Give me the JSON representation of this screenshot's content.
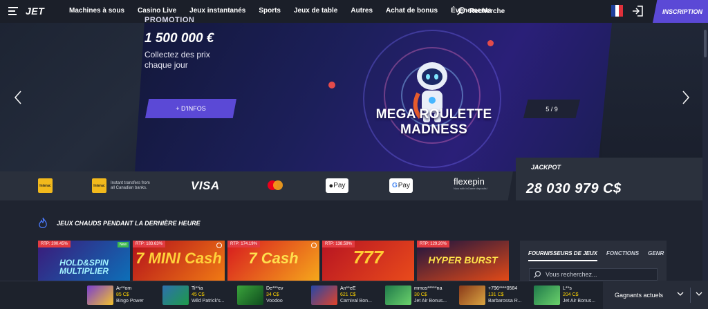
{
  "header": {
    "logo": "JET",
    "nav": [
      "Machines à sous",
      "Casino Live",
      "Jeux instantanés",
      "Sports",
      "Jeux de table",
      "Autres",
      "Achat de bonus",
      "Événements"
    ],
    "search_label": "Recherche",
    "signup_label": "INSCRIPTION"
  },
  "banner": {
    "promo_label": "PROMOTION",
    "amount": "1 500 000 €",
    "description": "Collectez des prix chaque jour",
    "button_label": "+ D'INFOS",
    "game_title": "MEGA ROULETTE MADNESS",
    "counter": "5 / 9"
  },
  "payments": {
    "interac_note": "Instant transfers from all Canadian banks.",
    "visa": "VISA",
    "apple_pay": "Pay",
    "google_pay": "Pay",
    "flexepin": "flexepin",
    "flexepin_sub": "Now with InGame deposits!"
  },
  "jackpot": {
    "label": "JACKPOT",
    "value": "28 030 979 C$"
  },
  "hot_games": {
    "title": "JEUX CHAUDS PENDANT LA DERNIÈRE HEURE",
    "cards": [
      {
        "rtp": "RTP: 200.45%",
        "title": "HOLD&SPIN MULTIPLIER",
        "badge": "New",
        "colors": [
          "#3b1a7a",
          "#0d6fb8"
        ]
      },
      {
        "rtp": "RTP: 183.63%",
        "title": "7 MINI Cash",
        "colors": [
          "#b3101b",
          "#f07a14"
        ]
      },
      {
        "rtp": "RTP: 174.19%",
        "title": "7 Cash",
        "colors": [
          "#d7191f",
          "#f6a81b"
        ]
      },
      {
        "rtp": "RTP: 138.59%",
        "title": "777",
        "colors": [
          "#b71422",
          "#e94b1b"
        ]
      },
      {
        "rtp": "RTP: 129.20%",
        "title": "HYPER BURST",
        "colors": [
          "#1a1340",
          "#e24a17"
        ]
      }
    ]
  },
  "providers": {
    "tabs": [
      "FOURNISSEURS DE JEUX",
      "FONCTIONS",
      "GENR"
    ],
    "search_placeholder": "Vous recherchez..."
  },
  "winners": {
    "items": [
      {
        "name": "Ar**om",
        "amount": "85 C$",
        "game": "Bingo Power",
        "color": "#7a3fd0"
      },
      {
        "name": "Ti**ia",
        "amount": "45 C$",
        "game": "Wild Patrick's...",
        "color": "#2d6fae"
      },
      {
        "name": "De***ev",
        "amount": "34 C$",
        "game": "Voodoo",
        "color": "#3aa33b"
      },
      {
        "name": "An**eE",
        "amount": "621 C$",
        "game": "Carnival Bon...",
        "color": "#2447a8"
      },
      {
        "name": "mmos*****na",
        "amount": "30 C$",
        "game": "Jet Air Bonus...",
        "color": "#1f7a4a"
      },
      {
        "name": "+796****0584",
        "amount": "131 C$",
        "game": "Barbarossa R...",
        "color": "#8a3a1a"
      },
      {
        "name": "L**s",
        "amount": "204 C$",
        "game": "Jet Air Bonus...",
        "color": "#1f7a4a"
      }
    ],
    "current_label": "Gagnants actuels"
  }
}
